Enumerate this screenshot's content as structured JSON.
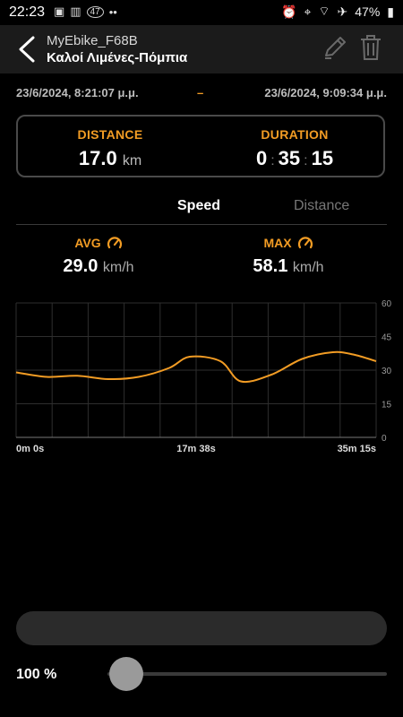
{
  "status_bar": {
    "time": "22:23",
    "badge": "47",
    "battery": "47%"
  },
  "header": {
    "device_name": "MyEbike_F68B",
    "route_name": "Καλοί Λιμένες-Πόμπια"
  },
  "dates": {
    "start": "23/6/2024, 8:21:07 μ.μ.",
    "separator": "–",
    "end": "23/6/2024, 9:09:34 μ.μ."
  },
  "summary": {
    "distance_label": "DISTANCE",
    "distance_value": "17.0",
    "distance_unit": "km",
    "duration_label": "DURATION",
    "duration_h": "0",
    "duration_m": "35",
    "duration_s": "15",
    "colon": ":"
  },
  "tabs": {
    "speed": "Speed",
    "distance": "Distance",
    "active": "speed"
  },
  "stats": {
    "avg_label": "AVG",
    "avg_value": "29.0",
    "avg_unit": "km/h",
    "max_label": "MAX",
    "max_value": "58.1",
    "max_unit": "km/h"
  },
  "colors": {
    "accent": "#f29c24",
    "line": "#f29c24",
    "grid": "#2e2e2e",
    "text_muted": "#9a9a9a"
  },
  "chart_data": {
    "type": "line",
    "x_tick_labels": [
      "0m 0s",
      "17m 38s",
      "35m 15s"
    ],
    "y_tick_labels": [
      "60",
      "45",
      "30",
      "15",
      "0"
    ],
    "ylim": [
      0,
      60
    ],
    "xlim_seconds": [
      0,
      2115
    ],
    "grid": true,
    "series": [
      {
        "x": [
          0,
          180,
          360,
          540,
          720,
          900,
          1020,
          1200,
          1320,
          1500,
          1680,
          1860,
          1980,
          2115
        ],
        "values": [
          29,
          27,
          27.5,
          26,
          27,
          31,
          36,
          34,
          25,
          28,
          35,
          38,
          37,
          34
        ]
      }
    ]
  },
  "controls": {
    "zoom_label": "100 %",
    "zoom_fraction": 0.0
  }
}
